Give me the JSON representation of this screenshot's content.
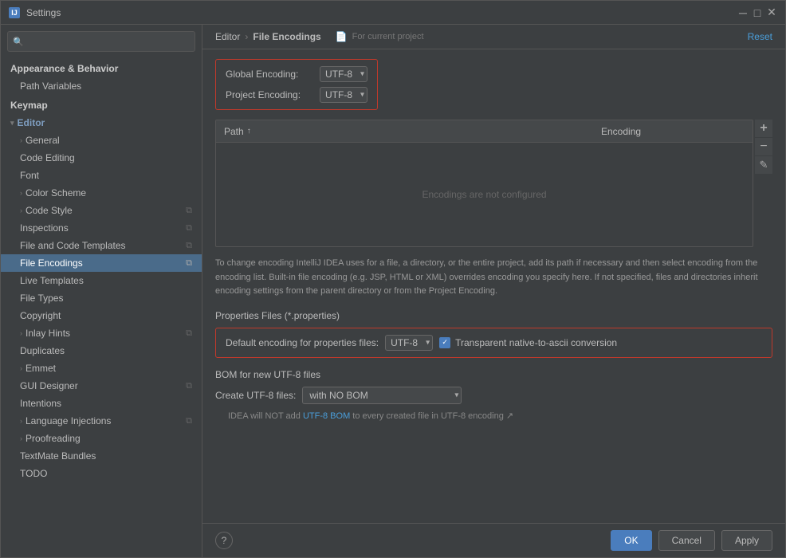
{
  "window": {
    "title": "Settings",
    "icon": "IJ"
  },
  "search": {
    "placeholder": ""
  },
  "sidebar": {
    "items": [
      {
        "id": "appearance",
        "label": "Appearance & Behavior",
        "level": 0,
        "type": "header",
        "indent": ""
      },
      {
        "id": "path-variables",
        "label": "Path Variables",
        "level": 1,
        "type": "item",
        "indent": "1"
      },
      {
        "id": "keymap",
        "label": "Keymap",
        "level": 0,
        "type": "header",
        "indent": ""
      },
      {
        "id": "editor",
        "label": "Editor",
        "level": 0,
        "type": "section",
        "indent": "",
        "expanded": true
      },
      {
        "id": "general",
        "label": "General",
        "level": 1,
        "type": "expandable",
        "indent": "1"
      },
      {
        "id": "code-editing",
        "label": "Code Editing",
        "level": 1,
        "type": "item",
        "indent": "1"
      },
      {
        "id": "font",
        "label": "Font",
        "level": 1,
        "type": "item",
        "indent": "1"
      },
      {
        "id": "color-scheme",
        "label": "Color Scheme",
        "level": 1,
        "type": "expandable",
        "indent": "1"
      },
      {
        "id": "code-style",
        "label": "Code Style",
        "level": 1,
        "type": "expandable",
        "indent": "1",
        "hasIcon": true
      },
      {
        "id": "inspections",
        "label": "Inspections",
        "level": 1,
        "type": "item",
        "indent": "1",
        "hasIcon": true
      },
      {
        "id": "file-and-code-templates",
        "label": "File and Code Templates",
        "level": 1,
        "type": "item",
        "indent": "1",
        "hasIcon": true
      },
      {
        "id": "file-encodings",
        "label": "File Encodings",
        "level": 1,
        "type": "item",
        "indent": "1",
        "hasIcon": true,
        "selected": true
      },
      {
        "id": "live-templates",
        "label": "Live Templates",
        "level": 1,
        "type": "item",
        "indent": "1"
      },
      {
        "id": "file-types",
        "label": "File Types",
        "level": 1,
        "type": "item",
        "indent": "1"
      },
      {
        "id": "copyright",
        "label": "Copyright",
        "level": 1,
        "type": "item",
        "indent": "1"
      },
      {
        "id": "inlay-hints",
        "label": "Inlay Hints",
        "level": 1,
        "type": "expandable",
        "indent": "1",
        "hasIcon": true
      },
      {
        "id": "duplicates",
        "label": "Duplicates",
        "level": 1,
        "type": "item",
        "indent": "1"
      },
      {
        "id": "emmet",
        "label": "Emmet",
        "level": 1,
        "type": "expandable",
        "indent": "1"
      },
      {
        "id": "gui-designer",
        "label": "GUI Designer",
        "level": 1,
        "type": "item",
        "indent": "1",
        "hasIcon": true
      },
      {
        "id": "intentions",
        "label": "Intentions",
        "level": 1,
        "type": "item",
        "indent": "1"
      },
      {
        "id": "language-injections",
        "label": "Language Injections",
        "level": 1,
        "type": "expandable",
        "indent": "1",
        "hasIcon": true
      },
      {
        "id": "proofreading",
        "label": "Proofreading",
        "level": 1,
        "type": "expandable",
        "indent": "1"
      },
      {
        "id": "textmate-bundles",
        "label": "TextMate Bundles",
        "level": 1,
        "type": "item",
        "indent": "1"
      },
      {
        "id": "todo",
        "label": "TODO",
        "level": 1,
        "type": "item",
        "indent": "1"
      }
    ]
  },
  "header": {
    "breadcrumb_parent": "Editor",
    "breadcrumb_current": "File Encodings",
    "for_project": "For current project",
    "reset_label": "Reset"
  },
  "encoding": {
    "global_label": "Global Encoding:",
    "global_value": "UTF-8",
    "project_label": "Project Encoding:",
    "project_value": "UTF-8",
    "table_col_path": "Path",
    "table_col_encoding": "Encoding",
    "table_empty": "Encodings are not configured"
  },
  "description": {
    "text": "To change encoding IntelliJ IDEA uses for a file, a directory, or the entire project, add its path if necessary and then select encoding from the encoding list. Built-in file encoding (e.g. JSP, HTML or XML) overrides encoding you specify here. If not specified, files and directories inherit encoding settings from the parent directory or from the Project Encoding."
  },
  "properties": {
    "section_title": "Properties Files (*.properties)",
    "default_label": "Default encoding for properties files:",
    "default_value": "UTF-8",
    "checkbox_label": "Transparent native-to-ascii conversion",
    "checkbox_checked": true
  },
  "bom": {
    "section_title": "BOM for new UTF-8 files",
    "create_label": "Create UTF-8 files:",
    "create_value": "with NO BOM",
    "note_text": "IDEA will NOT add UTF-8 BOM to every created file in UTF-8 encoding",
    "note_link": "UTF-8 BOM"
  },
  "bottom": {
    "ok_label": "OK",
    "cancel_label": "Cancel",
    "apply_label": "Apply",
    "help_label": "?"
  },
  "icons": {
    "search": "🔍",
    "arrow_right": "›",
    "chevron_right": "›",
    "chevron_down": "∨",
    "sort_asc": "↑",
    "close": "✕",
    "settings_copy": "⧉",
    "plus": "+",
    "minus": "−",
    "edit": "✎"
  }
}
